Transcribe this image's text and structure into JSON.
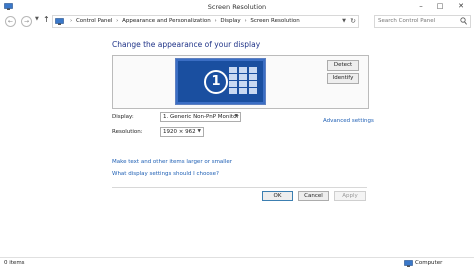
{
  "window": {
    "title": "Screen Resolution"
  },
  "nav": {
    "breadcrumbs": [
      "Control Panel",
      "Appearance and Personalization",
      "Display",
      "Screen Resolution"
    ],
    "search_placeholder": "Search Control Panel"
  },
  "main": {
    "heading": "Change the appearance of your display",
    "monitor_number": "1",
    "detect_label": "Detect",
    "identify_label": "Identify",
    "display_label": "Display:",
    "display_value": "1. Generic Non-PnP Monitor",
    "resolution_label": "Resolution:",
    "resolution_value": "1920 × 962",
    "advanced_link": "Advanced settings",
    "text_size_link": "Make text and other items larger or smaller",
    "which_settings_link": "What display settings should I choose?"
  },
  "buttons": {
    "ok": "OK",
    "cancel": "Cancel",
    "apply": "Apply"
  },
  "status": {
    "items": "0 items",
    "location": "Computer"
  },
  "icons": {
    "app": "control-panel-icon",
    "back": "back-arrow-icon",
    "forward": "forward-arrow-icon",
    "up": "up-arrow-icon",
    "refresh": "refresh-icon",
    "search": "search-icon",
    "computer": "computer-icon"
  },
  "colors": {
    "heading": "#1e3287",
    "link": "#1e5fb4",
    "monitor": "#1a4fa0"
  }
}
